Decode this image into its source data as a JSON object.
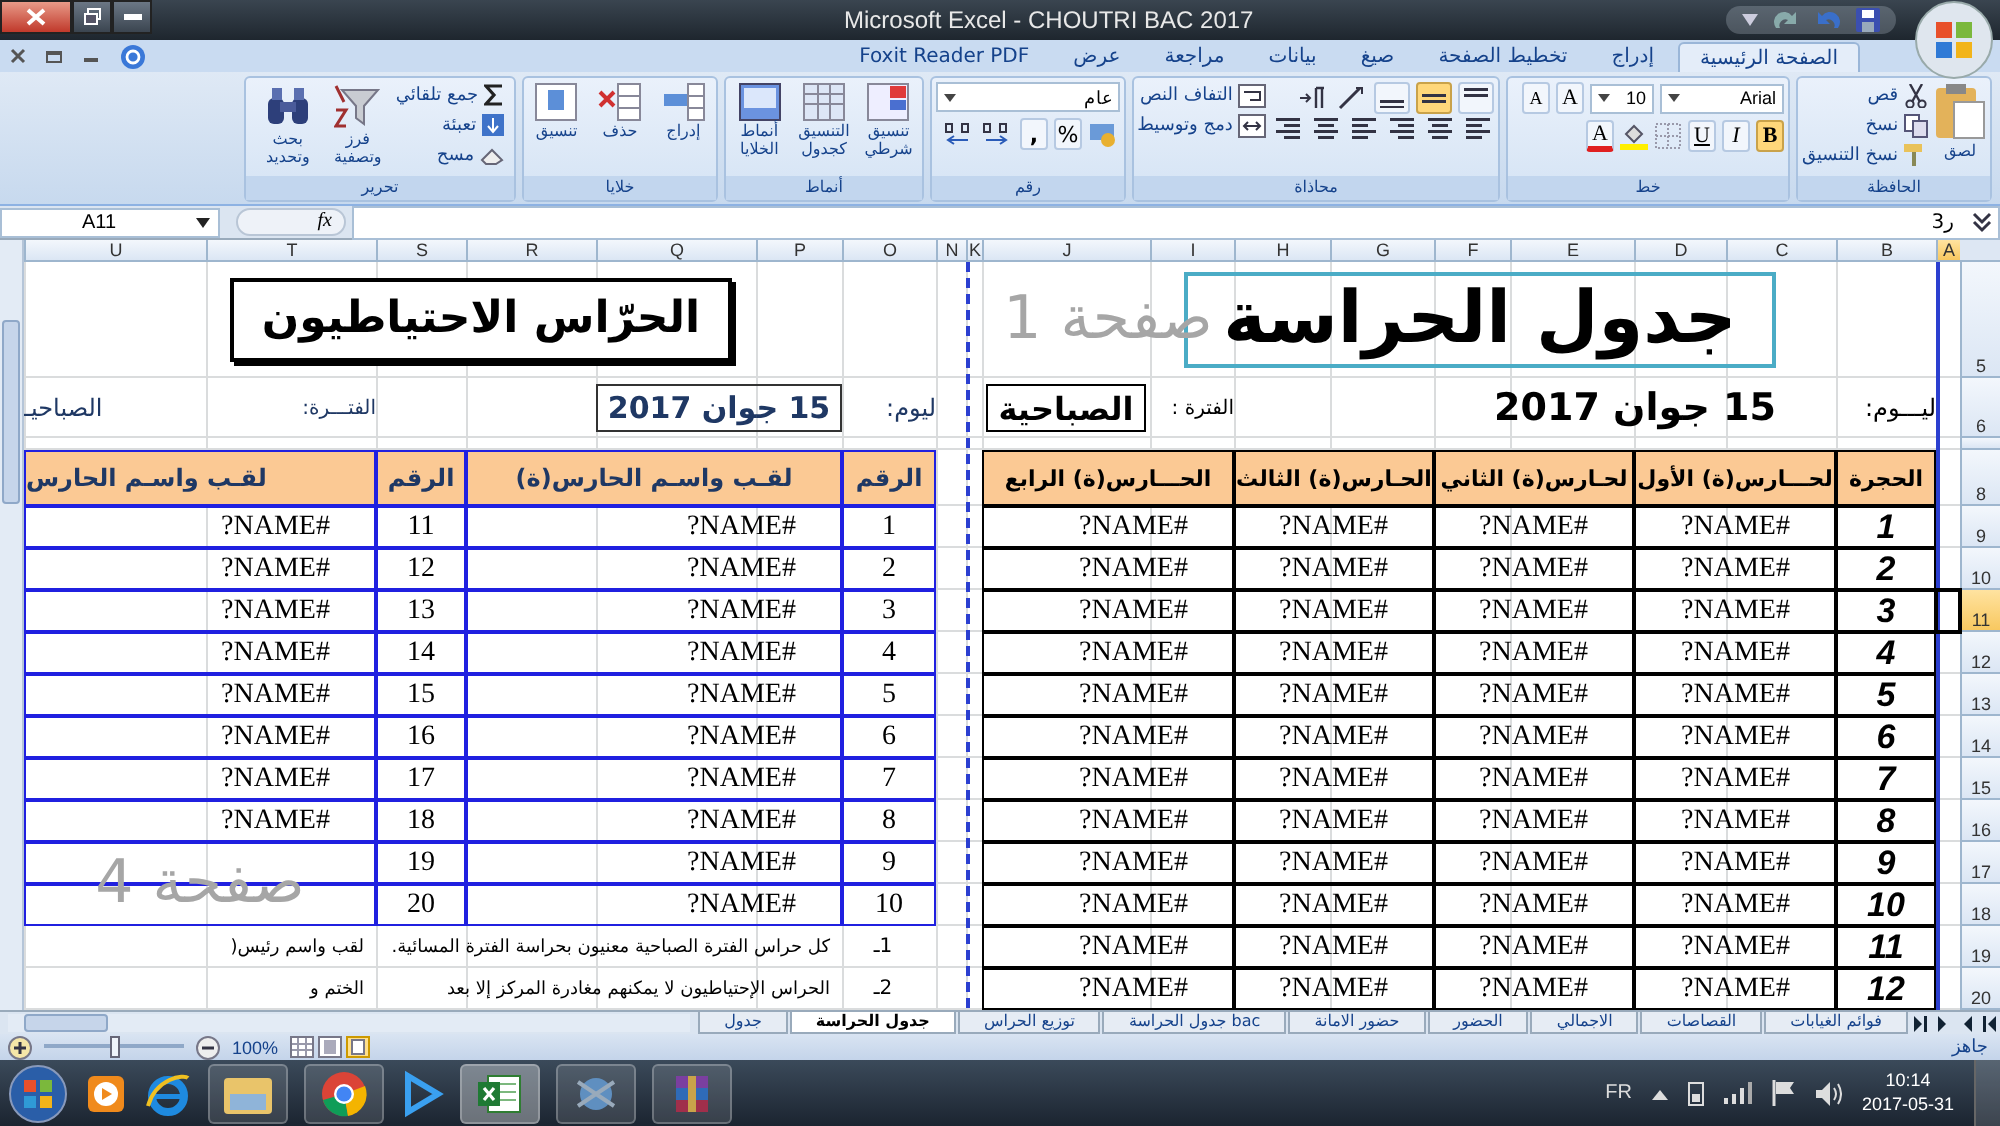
{
  "title_bar": {
    "title": "Microsoft Excel - CHOUTRI BAC 2017"
  },
  "ribbon_tabs": [
    {
      "label": "الصفحة الرئيسية",
      "selected": true
    },
    {
      "label": "إدراج",
      "selected": false
    },
    {
      "label": "تخطيط الصفحة",
      "selected": false
    },
    {
      "label": "صيغ",
      "selected": false
    },
    {
      "label": "بيانات",
      "selected": false
    },
    {
      "label": "مراجعة",
      "selected": false
    },
    {
      "label": "عرض",
      "selected": false
    },
    {
      "label": "Foxit Reader PDF",
      "selected": false
    }
  ],
  "ribbon": {
    "clipboard": {
      "title": "الحافظة",
      "paste": "لصق",
      "cut": "قص",
      "copy": "نسخ",
      "format_painter": "نسخ التنسيق"
    },
    "font": {
      "title": "خط",
      "font_name": "Arial",
      "font_size": "10",
      "grow": "A",
      "shrink": "A",
      "bold": {
        "label": "B",
        "on": true
      },
      "italic": {
        "label": "I",
        "on": false
      },
      "underline": {
        "label": "U",
        "on": false
      },
      "font_color": "A"
    },
    "alignment": {
      "title": "محاذاة",
      "wrap_text": "التفاف النص",
      "merge_center": "دمج وتوسيط",
      "vertical": [
        {
          "selected": false
        },
        {
          "selected": true
        },
        {
          "selected": false
        }
      ]
    },
    "number": {
      "title": "رقم",
      "format": "عام",
      "percent": "%",
      "comma": ","
    },
    "styles": {
      "title": "أنماط",
      "conditional": "تنسيق شرطي",
      "as_table": "التنسيق كجدول",
      "cell_styles": "أنماط الخلايا"
    },
    "cells": {
      "title": "خلايا",
      "insert": "إدراج",
      "delete": "حذف",
      "format": "تنسيق"
    },
    "editing": {
      "title": "تحرير",
      "autosum": "جمع تلقائي",
      "fill": "تعبئة",
      "clear": "مسح",
      "sort_filter": "فرز وتصفية",
      "find_select": "بحث وتحديد"
    }
  },
  "formula_bar": {
    "name_box": "A11",
    "function_label": "fx",
    "value": "ر3"
  },
  "columns": [
    {
      "label": "A",
      "selected": true
    },
    {
      "label": "B",
      "selected": false
    },
    {
      "label": "C",
      "selected": false
    },
    {
      "label": "D",
      "selected": false
    },
    {
      "label": "E",
      "selected": false
    },
    {
      "label": "F",
      "selected": false
    },
    {
      "label": "G",
      "selected": false
    },
    {
      "label": "H",
      "selected": false
    },
    {
      "label": "I",
      "selected": false
    },
    {
      "label": "J",
      "selected": false
    },
    {
      "label": "K",
      "selected": false
    },
    {
      "label": "N",
      "selected": false
    },
    {
      "label": "O",
      "selected": false
    },
    {
      "label": "P",
      "selected": false
    },
    {
      "label": "Q",
      "selected": false
    },
    {
      "label": "R",
      "selected": false
    },
    {
      "label": "S",
      "selected": false
    },
    {
      "label": "T",
      "selected": false
    },
    {
      "label": "U",
      "selected": false
    }
  ],
  "rows": [
    {
      "label": "5",
      "selected": false
    },
    {
      "label": "6",
      "selected": false
    },
    {
      "label": "8",
      "selected": false
    },
    {
      "label": "9",
      "selected": false
    },
    {
      "label": "10",
      "selected": false
    },
    {
      "label": "11",
      "selected": true
    },
    {
      "label": "12",
      "selected": false
    },
    {
      "label": "13",
      "selected": false
    },
    {
      "label": "14",
      "selected": false
    },
    {
      "label": "15",
      "selected": false
    },
    {
      "label": "16",
      "selected": false
    },
    {
      "label": "17",
      "selected": false
    },
    {
      "label": "18",
      "selected": false
    },
    {
      "label": "19",
      "selected": false
    },
    {
      "label": "20",
      "selected": false
    }
  ],
  "main_sheet": {
    "title": "جدول الحراسة",
    "day_label": "ليـــوم:",
    "date": "15 جوان 2017",
    "period_label": "الفترة :",
    "period": "الصباحية",
    "columns": [
      "الحجرة",
      "لحـــارس(ة) الأول",
      "لحـارس(ة) الثاني",
      "الحـارس(ة) الثالث",
      "الحـــارس(ة) الرابع"
    ],
    "rows": [
      {
        "room": "1",
        "guards": [
          "#NAME?",
          "#NAME?",
          "#NAME?",
          "#NAME?"
        ]
      },
      {
        "room": "2",
        "guards": [
          "#NAME?",
          "#NAME?",
          "#NAME?",
          "#NAME?"
        ]
      },
      {
        "room": "3",
        "guards": [
          "#NAME?",
          "#NAME?",
          "#NAME?",
          "#NAME?"
        ]
      },
      {
        "room": "4",
        "guards": [
          "#NAME?",
          "#NAME?",
          "#NAME?",
          "#NAME?"
        ]
      },
      {
        "room": "5",
        "guards": [
          "#NAME?",
          "#NAME?",
          "#NAME?",
          "#NAME?"
        ]
      },
      {
        "room": "6",
        "guards": [
          "#NAME?",
          "#NAME?",
          "#NAME?",
          "#NAME?"
        ]
      },
      {
        "room": "7",
        "guards": [
          "#NAME?",
          "#NAME?",
          "#NAME?",
          "#NAME?"
        ]
      },
      {
        "room": "8",
        "guards": [
          "#NAME?",
          "#NAME?",
          "#NAME?",
          "#NAME?"
        ]
      },
      {
        "room": "9",
        "guards": [
          "#NAME?",
          "#NAME?",
          "#NAME?",
          "#NAME?"
        ]
      },
      {
        "room": "10",
        "guards": [
          "#NAME?",
          "#NAME?",
          "#NAME?",
          "#NAME?"
        ]
      },
      {
        "room": "11",
        "guards": [
          "#NAME?",
          "#NAME?",
          "#NAME?",
          "#NAME?"
        ]
      },
      {
        "room": "12",
        "guards": [
          "#NAME?",
          "#NAME?",
          "#NAME?",
          "#NAME?"
        ]
      }
    ]
  },
  "reserve_sheet": {
    "title": "الحرّاس الاحتياطيون",
    "day_label": "ليوم:",
    "date": "15 جوان 2017",
    "period_label": "الفتـــرة:",
    "period": "الصباحيـ",
    "columns": [
      "الرقم",
      "لقـب واسـم الحارس(ة)",
      "الرقم",
      "لقـب واسـم الحارس"
    ],
    "rows": [
      {
        "number": "1",
        "name": "#NAME?",
        "number_2": "11",
        "name_2": "#NAME?"
      },
      {
        "number": "2",
        "name": "#NAME?",
        "number_2": "12",
        "name_2": "#NAME?"
      },
      {
        "number": "3",
        "name": "#NAME?",
        "number_2": "13",
        "name_2": "#NAME?"
      },
      {
        "number": "4",
        "name": "#NAME?",
        "number_2": "14",
        "name_2": "#NAME?"
      },
      {
        "number": "5",
        "name": "#NAME?",
        "number_2": "15",
        "name_2": "#NAME?"
      },
      {
        "number": "6",
        "name": "#NAME?",
        "number_2": "16",
        "name_2": "#NAME?"
      },
      {
        "number": "7",
        "name": "#NAME?",
        "number_2": "17",
        "name_2": "#NAME?"
      },
      {
        "number": "8",
        "name": "#NAME?",
        "number_2": "18",
        "name_2": "#NAME?"
      },
      {
        "number": "9",
        "name": "#NAME?",
        "number_2": "19"
      },
      {
        "number": "10",
        "name": "#NAME?",
        "number_2": "20"
      }
    ]
  },
  "notes": [
    {
      "marker": "1ـ",
      "text": "كل حراس الفترة الصباحية معنيون بحراسة الفترة المسائية."
    },
    {
      "marker": "2ـ",
      "text": "الحراس الإحتياطيون لا يمكنهم مغادرة المركز إلا بعد"
    }
  ],
  "side_notes": [
    "لقب واسم رئيس(",
    "الختم و"
  ],
  "page_labels": [
    "صفحة 1",
    "صفحة 4"
  ],
  "sheet_tabs": [
    {
      "label": "فوائم الغيابات",
      "selected": false
    },
    {
      "label": "القصاصات",
      "selected": false
    },
    {
      "label": "الاجمالي",
      "selected": false
    },
    {
      "label": "الحضور",
      "selected": false
    },
    {
      "label": "حضور الامانة",
      "selected": false
    },
    {
      "label": "جدول الحراسة bac",
      "selected": false
    },
    {
      "label": "توزيع الحراس",
      "selected": false
    },
    {
      "label": "جدول الحراسة",
      "selected": true
    },
    {
      "label": "جدول",
      "selected": false
    }
  ],
  "status_bar": {
    "status": "جاهز",
    "zoom": "100%",
    "level": 0.5
  },
  "taskbar": {
    "language": "FR",
    "time": "10:14",
    "date": "2017-05-31"
  }
}
